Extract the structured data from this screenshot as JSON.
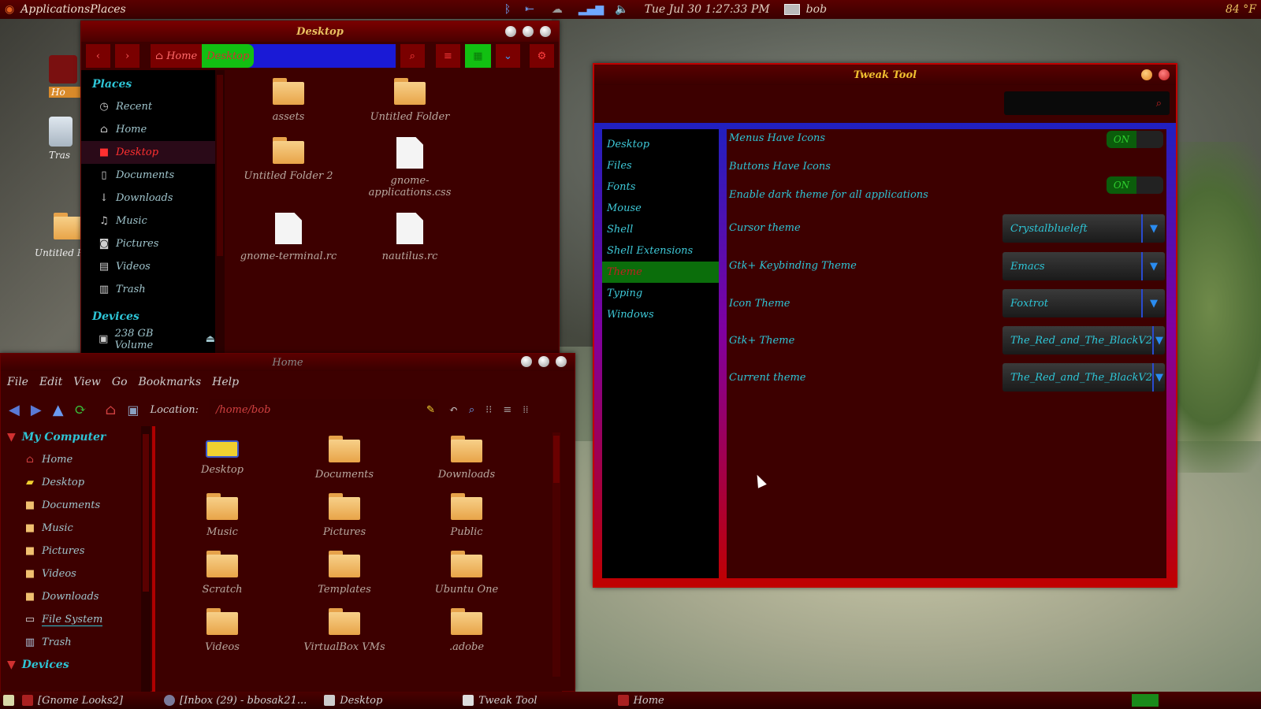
{
  "top_panel": {
    "menu_label": "ApplicationsPlaces",
    "clock": "Tue Jul 30   1:27:33 PM",
    "user": "bob",
    "temperature": "84 °F"
  },
  "desktop_icons": [
    "Ho",
    "Tras",
    "Untitled Fo"
  ],
  "desktop_window": {
    "title": "Desktop",
    "path": {
      "home": "Home",
      "current": "Desktop"
    },
    "places_header": "Places",
    "places": [
      "Recent",
      "Home",
      "Desktop",
      "Documents",
      "Downloads",
      "Music",
      "Pictures",
      "Videos",
      "Trash"
    ],
    "devices_header": "Devices",
    "devices": [
      "238 GB Volume"
    ],
    "files": [
      {
        "name": "assets",
        "kind": "folder"
      },
      {
        "name": "Untitled Folder",
        "kind": "folder"
      },
      {
        "name": "Untitled Folder 2",
        "kind": "folder"
      },
      {
        "name": "gnome-applications.css",
        "kind": "file"
      },
      {
        "name": "gnome-terminal.rc",
        "kind": "file"
      },
      {
        "name": "nautilus.rc",
        "kind": "file"
      }
    ]
  },
  "home_window": {
    "title": "Home",
    "menu": [
      "File",
      "Edit",
      "View",
      "Go",
      "Bookmarks",
      "Help"
    ],
    "location_label": "Location:",
    "location_value": "/home/bob",
    "tree_header": "My Computer",
    "tree": [
      "Home",
      "Desktop",
      "Documents",
      "Music",
      "Pictures",
      "Videos",
      "Downloads",
      "File System",
      "Trash"
    ],
    "devices_header": "Devices",
    "files": [
      {
        "name": "Desktop",
        "kind": "desktop"
      },
      {
        "name": "Documents",
        "kind": "folder"
      },
      {
        "name": "Downloads",
        "kind": "folder"
      },
      {
        "name": "Music",
        "kind": "folder"
      },
      {
        "name": "Pictures",
        "kind": "folder"
      },
      {
        "name": "Public",
        "kind": "folder"
      },
      {
        "name": "Scratch",
        "kind": "folder"
      },
      {
        "name": "Templates",
        "kind": "folder"
      },
      {
        "name": "Ubuntu One",
        "kind": "folder"
      },
      {
        "name": "Videos",
        "kind": "folder"
      },
      {
        "name": "VirtualBox VMs",
        "kind": "folder"
      },
      {
        "name": ".adobe",
        "kind": "folder"
      }
    ]
  },
  "tweak_tool": {
    "title": "Tweak Tool",
    "nav": [
      "Desktop",
      "Files",
      "Fonts",
      "Mouse",
      "Shell",
      "Shell Extensions",
      "Theme",
      "Typing",
      "Windows"
    ],
    "selected_nav": "Theme",
    "toggles": [
      {
        "label": "Menus Have Icons",
        "state": "ON"
      },
      {
        "label": "Buttons Have Icons",
        "state": "ON"
      },
      {
        "label": "Enable dark theme for all applications",
        "state": "ON"
      }
    ],
    "combos": [
      {
        "label": "Cursor theme",
        "value": "Crystalblueleft"
      },
      {
        "label": "Gtk+ Keybinding Theme",
        "value": "Emacs"
      },
      {
        "label": "Icon Theme",
        "value": "Foxtrot"
      },
      {
        "label": "Gtk+ Theme",
        "value": "The_Red_and_The_BlackV2"
      },
      {
        "label": "Current theme",
        "value": "The_Red_and_The_BlackV2"
      }
    ]
  },
  "taskbar": {
    "items": [
      "[Gnome Looks2]",
      "[Inbox (29) - bbosak21...",
      "Desktop",
      "Tweak Tool",
      "Home"
    ]
  },
  "colors": {
    "accent_red": "#7a0000",
    "text_cyan": "#2ec5d6",
    "folder": "#f7d089",
    "selected_green": "#0b6e0b"
  }
}
